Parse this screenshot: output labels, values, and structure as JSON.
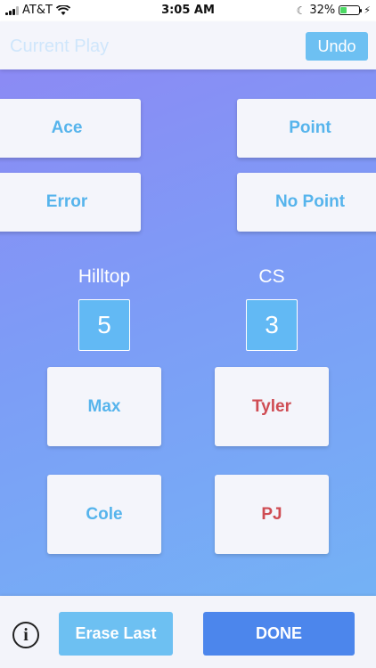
{
  "status_bar": {
    "carrier": "AT&T",
    "time": "3:05 AM",
    "battery_percent": "32%",
    "battery_level": 0.32,
    "icons": [
      "signal-icon",
      "wifi-icon",
      "moon-icon",
      "battery-icon",
      "charging-icon"
    ]
  },
  "header": {
    "title": "Current Play",
    "undo_label": "Undo"
  },
  "actions": {
    "ace": "Ace",
    "point": "Point",
    "error": "Error",
    "no_point": "No Point"
  },
  "teams": [
    {
      "name": "Hilltop",
      "score": "5",
      "players": [
        "Max",
        "Cole"
      ],
      "color": "#56b4ec"
    },
    {
      "name": "CS",
      "score": "3",
      "players": [
        "Tyler",
        "PJ"
      ],
      "color": "#cf4c53"
    }
  ],
  "footer": {
    "erase_label": "Erase Last",
    "done_label": "DONE",
    "info_icon": "info-icon"
  },
  "colors": {
    "accent": "#6dc0f2",
    "primary": "#4c86ec",
    "team_home": "#56b4ec",
    "team_away": "#cf4c53"
  }
}
